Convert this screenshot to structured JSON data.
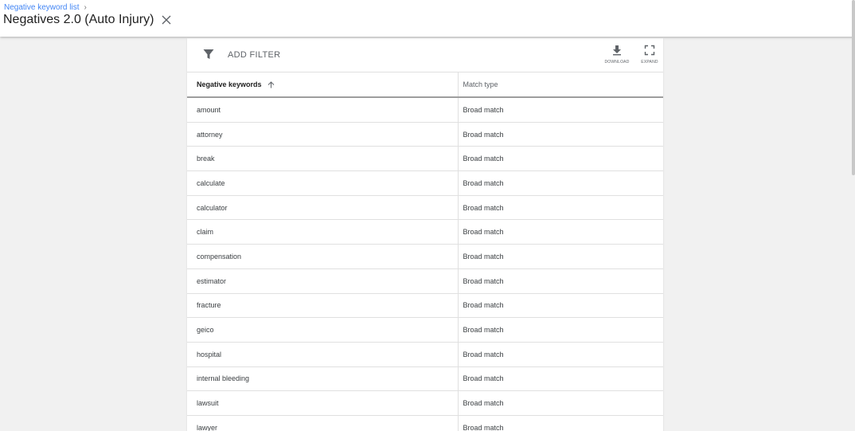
{
  "header": {
    "breadcrumb": "Negative keyword list",
    "breadcrumb_separator": "›",
    "title": "Negatives 2.0 (Auto Injury)",
    "close_icon": "close-icon"
  },
  "toolbar": {
    "filter_icon": "filter-icon",
    "add_filter_label": "ADD FILTER",
    "download_label": "DOWNLOAD",
    "download_icon": "download-icon",
    "expand_label": "EXPAND",
    "expand_icon": "fullscreen-icon"
  },
  "table": {
    "columns": [
      {
        "label": "Negative keywords",
        "sorted": "ascending"
      },
      {
        "label": "Match type"
      }
    ],
    "rows": [
      {
        "keyword": "amount",
        "match_type": "Broad match"
      },
      {
        "keyword": "attorney",
        "match_type": "Broad match"
      },
      {
        "keyword": "break",
        "match_type": "Broad match"
      },
      {
        "keyword": "calculate",
        "match_type": "Broad match"
      },
      {
        "keyword": "calculator",
        "match_type": "Broad match"
      },
      {
        "keyword": "claim",
        "match_type": "Broad match"
      },
      {
        "keyword": "compensation",
        "match_type": "Broad match"
      },
      {
        "keyword": "estimator",
        "match_type": "Broad match"
      },
      {
        "keyword": "fracture",
        "match_type": "Broad match"
      },
      {
        "keyword": "geico",
        "match_type": "Broad match"
      },
      {
        "keyword": "hospital",
        "match_type": "Broad match"
      },
      {
        "keyword": "internal bleeding",
        "match_type": "Broad match"
      },
      {
        "keyword": "lawsuit",
        "match_type": "Broad match"
      },
      {
        "keyword": "lawyer",
        "match_type": "Broad match"
      }
    ]
  },
  "colors": {
    "link": "#4285f4",
    "background": "#f1f1f1",
    "card": "#ffffff"
  }
}
